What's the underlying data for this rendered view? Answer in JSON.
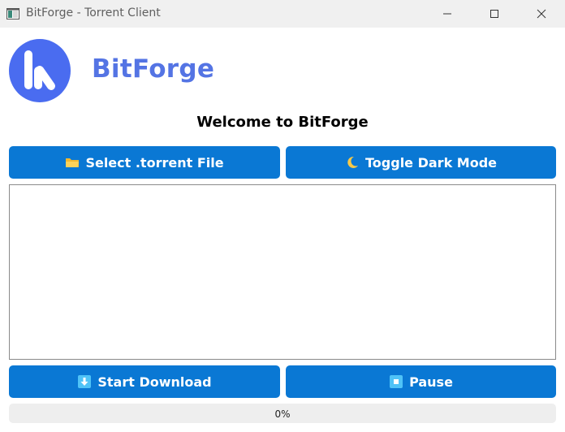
{
  "window": {
    "title": "BitForge - Torrent Client"
  },
  "header": {
    "brand": "BitForge",
    "welcome": "Welcome to BitForge",
    "logo_icon": "bitforge-logo",
    "brand_color": "#5474e4"
  },
  "actions": {
    "select_label": "Select .torrent File",
    "select_icon": "folder-icon",
    "dark_label": "Toggle Dark Mode",
    "dark_icon": "moon-icon",
    "start_label": "Start Download",
    "start_icon": "download-arrow-icon",
    "pause_label": "Pause",
    "pause_icon": "stop-icon"
  },
  "log": {
    "content": ""
  },
  "progress": {
    "value": 0,
    "label": "0%"
  },
  "colors": {
    "accent": "#0a78d4",
    "titlebar": "#f0f0f0"
  }
}
